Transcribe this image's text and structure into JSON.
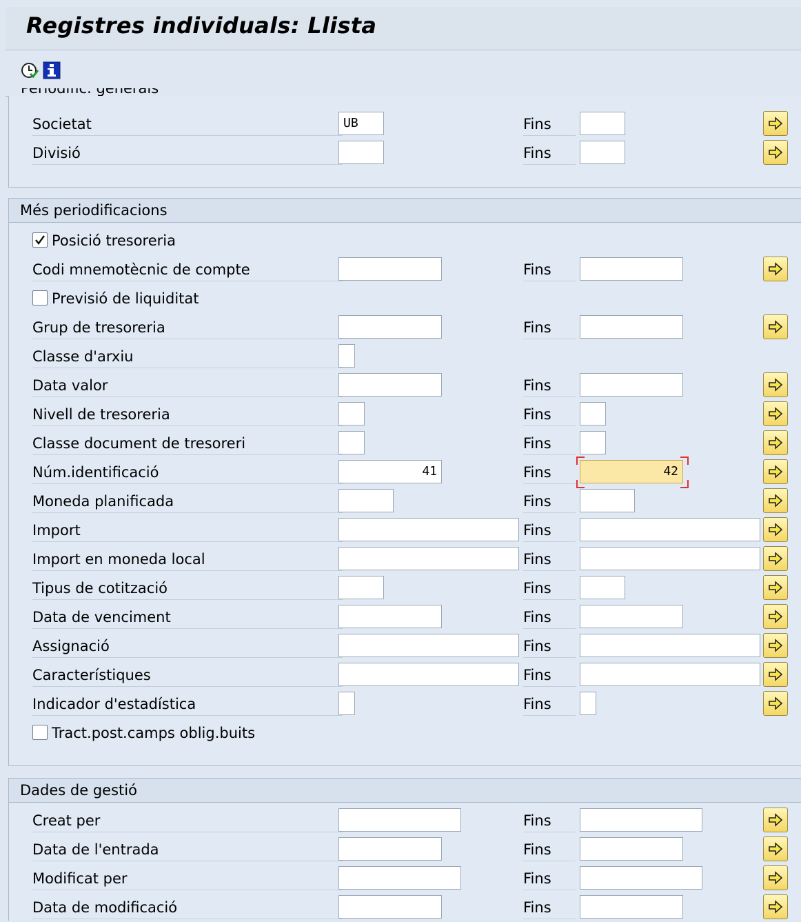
{
  "window": {
    "title": "Registres individuals: Llista"
  },
  "toolbar": {
    "icons": [
      "execute-clock-icon",
      "info-icon"
    ]
  },
  "groups": {
    "general": {
      "title_cut": "Periodific. generals",
      "rows": [
        {
          "label": "Societat",
          "from": "UB",
          "fins": "Fins",
          "to": ""
        },
        {
          "label": "Divisió",
          "from": "",
          "fins": "Fins",
          "to": ""
        }
      ]
    },
    "more": {
      "title": "Més periodificacions",
      "checkbox_position": {
        "label": "Posició tresoreria",
        "checked": true
      },
      "rows": [
        {
          "label": "Codi mnemotècnic de compte",
          "from": "",
          "fins": "Fins",
          "to": ""
        },
        {
          "label": "Grup de tresoreria",
          "from": "",
          "fins": "Fins",
          "to": ""
        },
        {
          "label": "Classe d'arxiu",
          "from": ""
        },
        {
          "label": "Data valor",
          "from": "",
          "fins": "Fins",
          "to": ""
        },
        {
          "label": "Nivell de tresoreria",
          "from": "",
          "fins": "Fins",
          "to": ""
        },
        {
          "label": "Classe document de tresoreri",
          "from": "",
          "fins": "Fins",
          "to": ""
        },
        {
          "label": "Núm.identificació",
          "from": "41",
          "fins": "Fins",
          "to": "42"
        },
        {
          "label": "Moneda planificada",
          "from": "",
          "fins": "Fins",
          "to": ""
        },
        {
          "label": "Import",
          "from": "",
          "fins": "Fins",
          "to": ""
        },
        {
          "label": "Import en moneda local",
          "from": "",
          "fins": "Fins",
          "to": ""
        },
        {
          "label": "Tipus de cotització",
          "from": "",
          "fins": "Fins",
          "to": ""
        },
        {
          "label": "Data de venciment",
          "from": "",
          "fins": "Fins",
          "to": ""
        },
        {
          "label": "Assignació",
          "from": "",
          "fins": "Fins",
          "to": ""
        },
        {
          "label": "Característiques",
          "from": "",
          "fins": "Fins",
          "to": ""
        },
        {
          "label": "Indicador d'estadística",
          "from": "",
          "fins": "Fins",
          "to": ""
        }
      ],
      "checkbox_liquidity": {
        "label": "Previsió de liquiditat",
        "checked": false
      },
      "checkbox_post": {
        "label": "Tract.post.camps oblig.buits",
        "checked": false
      }
    },
    "management": {
      "title": "Dades de gestió",
      "rows": [
        {
          "label": "Creat per",
          "from": "",
          "fins": "Fins",
          "to": ""
        },
        {
          "label": "Data de l'entrada",
          "from": "",
          "fins": "Fins",
          "to": ""
        },
        {
          "label": "Modificat per",
          "from": "",
          "fins": "Fins",
          "to": ""
        },
        {
          "label": "Data de modificació",
          "from": "",
          "fins": "Fins",
          "to": ""
        }
      ]
    }
  },
  "colors": {
    "focus_field": "#fbe7a6",
    "arrow_button": "#f4d763",
    "background": "#dfe8f2"
  }
}
